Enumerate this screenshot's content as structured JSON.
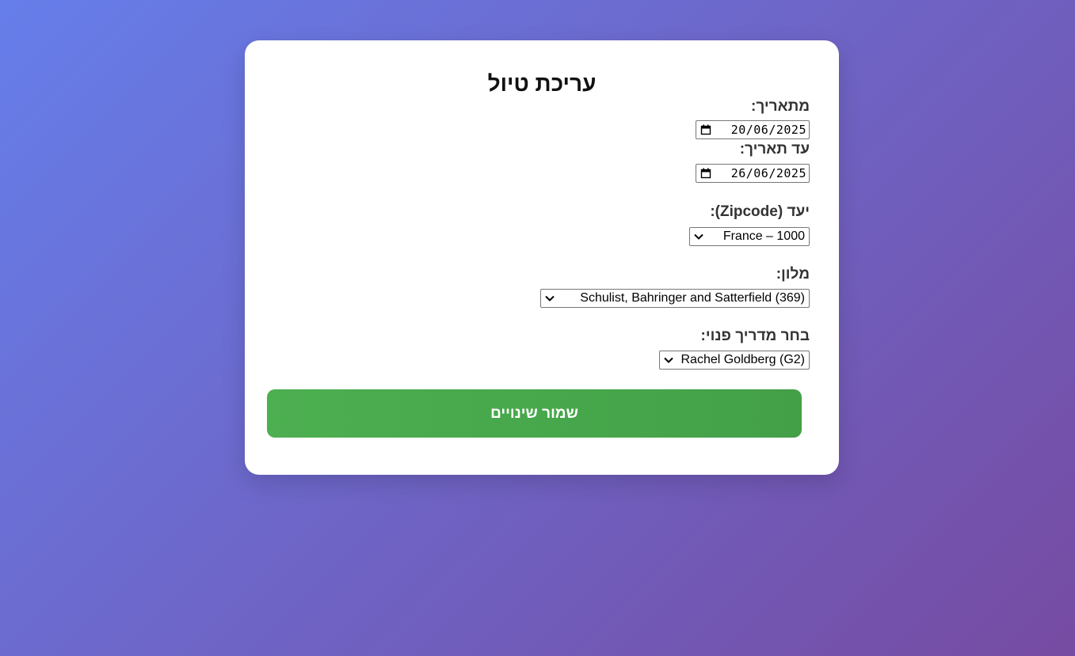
{
  "form": {
    "title": "עריכת טיול",
    "from_date_label": "מתאריך:",
    "from_date_value": "20/06/2025",
    "to_date_label": "עד תאריך:",
    "to_date_value": "26/06/2025",
    "destination_label": "יעד (Zipcode):",
    "destination_value": "France – 1000",
    "hotel_label": "מלון:",
    "hotel_value": "Schulist, Bahringer and Satterfield (369)",
    "guide_label": "בחר מדריך פנוי:",
    "guide_value": "Rachel Goldberg (G2)",
    "save_label": "שמור שינויים"
  },
  "icons": {
    "calendar": "calendar-icon",
    "dropdown": "chevron-down-icon"
  },
  "colors": {
    "background_start": "#667eea",
    "background_end": "#764ba2",
    "save_button": "#4caf50"
  }
}
